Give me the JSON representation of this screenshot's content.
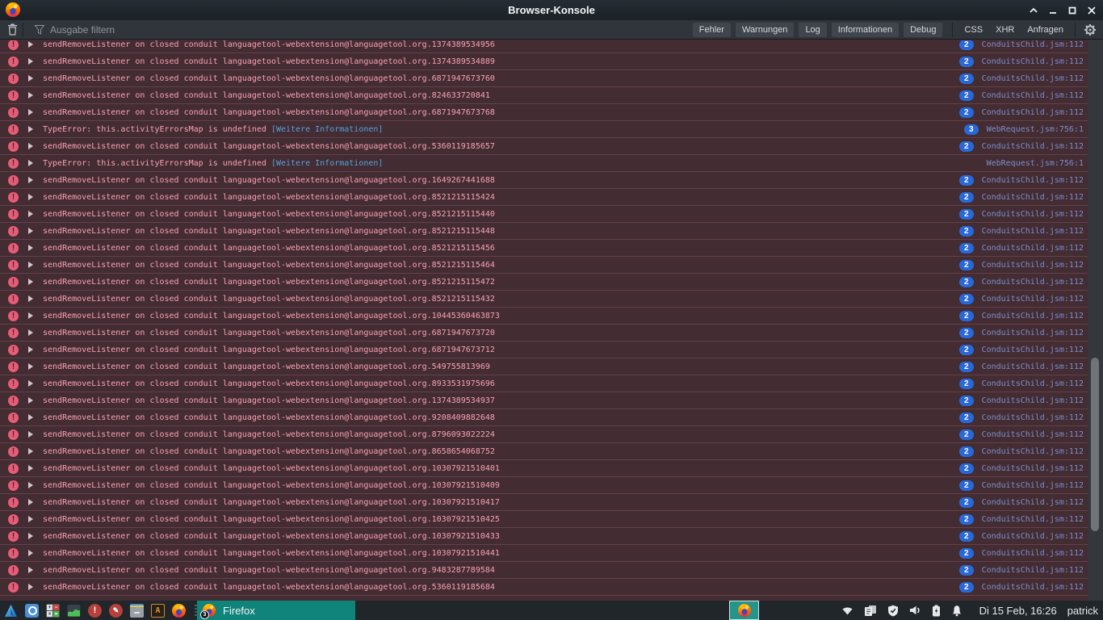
{
  "window": {
    "title": "Browser-Konsole"
  },
  "toolbar": {
    "filter_placeholder": "Ausgabe filtern",
    "level_buttons": [
      "Fehler",
      "Warnungen",
      "Log",
      "Informationen",
      "Debug"
    ],
    "category_buttons": [
      "CSS",
      "XHR",
      "Anfragen"
    ]
  },
  "console": {
    "rows": [
      {
        "message": "sendRemoveListener on closed conduit languagetool-webextension@languagetool.org.1374389534956",
        "link": null,
        "badge": "2",
        "source": "ConduitsChild.jsm:112"
      },
      {
        "message": "sendRemoveListener on closed conduit languagetool-webextension@languagetool.org.1374389534889",
        "link": null,
        "badge": "2",
        "source": "ConduitsChild.jsm:112"
      },
      {
        "message": "sendRemoveListener on closed conduit languagetool-webextension@languagetool.org.6871947673760",
        "link": null,
        "badge": "2",
        "source": "ConduitsChild.jsm:112"
      },
      {
        "message": "sendRemoveListener on closed conduit languagetool-webextension@languagetool.org.824633720841",
        "link": null,
        "badge": "2",
        "source": "ConduitsChild.jsm:112"
      },
      {
        "message": "sendRemoveListener on closed conduit languagetool-webextension@languagetool.org.6871947673768",
        "link": null,
        "badge": "2",
        "source": "ConduitsChild.jsm:112"
      },
      {
        "message": "TypeError: this.activityErrorsMap is undefined",
        "link": "[Weitere Informationen]",
        "badge": "3",
        "source": "WebRequest.jsm:756:1"
      },
      {
        "message": "sendRemoveListener on closed conduit languagetool-webextension@languagetool.org.5360119185657",
        "link": null,
        "badge": "2",
        "source": "ConduitsChild.jsm:112"
      },
      {
        "message": "TypeError: this.activityErrorsMap is undefined",
        "link": "[Weitere Informationen]",
        "badge": null,
        "source": "WebRequest.jsm:756:1"
      },
      {
        "message": "sendRemoveListener on closed conduit languagetool-webextension@languagetool.org.1649267441688",
        "link": null,
        "badge": "2",
        "source": "ConduitsChild.jsm:112"
      },
      {
        "message": "sendRemoveListener on closed conduit languagetool-webextension@languagetool.org.8521215115424",
        "link": null,
        "badge": "2",
        "source": "ConduitsChild.jsm:112"
      },
      {
        "message": "sendRemoveListener on closed conduit languagetool-webextension@languagetool.org.8521215115440",
        "link": null,
        "badge": "2",
        "source": "ConduitsChild.jsm:112"
      },
      {
        "message": "sendRemoveListener on closed conduit languagetool-webextension@languagetool.org.8521215115448",
        "link": null,
        "badge": "2",
        "source": "ConduitsChild.jsm:112"
      },
      {
        "message": "sendRemoveListener on closed conduit languagetool-webextension@languagetool.org.8521215115456",
        "link": null,
        "badge": "2",
        "source": "ConduitsChild.jsm:112"
      },
      {
        "message": "sendRemoveListener on closed conduit languagetool-webextension@languagetool.org.8521215115464",
        "link": null,
        "badge": "2",
        "source": "ConduitsChild.jsm:112"
      },
      {
        "message": "sendRemoveListener on closed conduit languagetool-webextension@languagetool.org.8521215115472",
        "link": null,
        "badge": "2",
        "source": "ConduitsChild.jsm:112"
      },
      {
        "message": "sendRemoveListener on closed conduit languagetool-webextension@languagetool.org.8521215115432",
        "link": null,
        "badge": "2",
        "source": "ConduitsChild.jsm:112"
      },
      {
        "message": "sendRemoveListener on closed conduit languagetool-webextension@languagetool.org.10445360463873",
        "link": null,
        "badge": "2",
        "source": "ConduitsChild.jsm:112"
      },
      {
        "message": "sendRemoveListener on closed conduit languagetool-webextension@languagetool.org.6871947673720",
        "link": null,
        "badge": "2",
        "source": "ConduitsChild.jsm:112"
      },
      {
        "message": "sendRemoveListener on closed conduit languagetool-webextension@languagetool.org.6871947673712",
        "link": null,
        "badge": "2",
        "source": "ConduitsChild.jsm:112"
      },
      {
        "message": "sendRemoveListener on closed conduit languagetool-webextension@languagetool.org.549755813969",
        "link": null,
        "badge": "2",
        "source": "ConduitsChild.jsm:112"
      },
      {
        "message": "sendRemoveListener on closed conduit languagetool-webextension@languagetool.org.8933531975696",
        "link": null,
        "badge": "2",
        "source": "ConduitsChild.jsm:112"
      },
      {
        "message": "sendRemoveListener on closed conduit languagetool-webextension@languagetool.org.1374389534937",
        "link": null,
        "badge": "2",
        "source": "ConduitsChild.jsm:112"
      },
      {
        "message": "sendRemoveListener on closed conduit languagetool-webextension@languagetool.org.9208409882648",
        "link": null,
        "badge": "2",
        "source": "ConduitsChild.jsm:112"
      },
      {
        "message": "sendRemoveListener on closed conduit languagetool-webextension@languagetool.org.8796093022224",
        "link": null,
        "badge": "2",
        "source": "ConduitsChild.jsm:112"
      },
      {
        "message": "sendRemoveListener on closed conduit languagetool-webextension@languagetool.org.8658654068752",
        "link": null,
        "badge": "2",
        "source": "ConduitsChild.jsm:112"
      },
      {
        "message": "sendRemoveListener on closed conduit languagetool-webextension@languagetool.org.10307921510401",
        "link": null,
        "badge": "2",
        "source": "ConduitsChild.jsm:112"
      },
      {
        "message": "sendRemoveListener on closed conduit languagetool-webextension@languagetool.org.10307921510409",
        "link": null,
        "badge": "2",
        "source": "ConduitsChild.jsm:112"
      },
      {
        "message": "sendRemoveListener on closed conduit languagetool-webextension@languagetool.org.10307921510417",
        "link": null,
        "badge": "2",
        "source": "ConduitsChild.jsm:112"
      },
      {
        "message": "sendRemoveListener on closed conduit languagetool-webextension@languagetool.org.10307921510425",
        "link": null,
        "badge": "2",
        "source": "ConduitsChild.jsm:112"
      },
      {
        "message": "sendRemoveListener on closed conduit languagetool-webextension@languagetool.org.10307921510433",
        "link": null,
        "badge": "2",
        "source": "ConduitsChild.jsm:112"
      },
      {
        "message": "sendRemoveListener on closed conduit languagetool-webextension@languagetool.org.10307921510441",
        "link": null,
        "badge": "2",
        "source": "ConduitsChild.jsm:112"
      },
      {
        "message": "sendRemoveListener on closed conduit languagetool-webextension@languagetool.org.9483287789584",
        "link": null,
        "badge": "2",
        "source": "ConduitsChild.jsm:112"
      },
      {
        "message": "sendRemoveListener on closed conduit languagetool-webextension@languagetool.org.5360119185684",
        "link": null,
        "badge": "2",
        "source": "ConduitsChild.jsm:112"
      }
    ]
  },
  "taskbar": {
    "task_button": {
      "label": "Firefox",
      "badge": "3"
    },
    "clock": "Di 15 Feb, 16:26",
    "user": "patrick"
  },
  "colors": {
    "error_row_bg": "#442c33",
    "error_text": "#f8a2b4",
    "error_icon": "#e75c77",
    "badge_blue": "#2868d9",
    "source_link": "#7b8ec9",
    "info_link": "#56a0da",
    "task_button_teal": "#10847a"
  }
}
